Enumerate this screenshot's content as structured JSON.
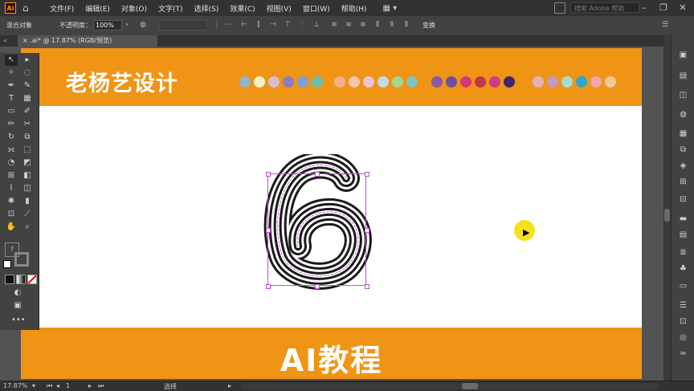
{
  "app": {
    "logo": "Ai",
    "menu": [
      "文件(F)",
      "编辑(E)",
      "对象(O)",
      "文字(T)",
      "选择(S)",
      "效果(C)",
      "视图(V)",
      "窗口(W)",
      "帮助(H)"
    ],
    "search_placeholder": "搜索 Adobe 帮助"
  },
  "control": {
    "object_type": "混合对象",
    "opacity_label": "不透明度：",
    "opacity_value": "100%",
    "dim_field": "",
    "transform_label": "变换"
  },
  "document": {
    "tab_title": ".ai* @ 17.87% (RGB/预览)"
  },
  "artboard": {
    "brand_title": "老杨艺设计",
    "course_title": "AI教程",
    "glyph": "6",
    "colors": {
      "banner": "#ef9414",
      "accent": "#ff9a00",
      "selection": "#c44bd6"
    },
    "swatches": [
      "#8fb6c9",
      "#f3f0c8",
      "#d8bcd0",
      "#8f7bc0",
      "#7ea0d8",
      "#6bbfb0",
      "#f4b28a",
      "#f6c7b0",
      "#f0c2d8",
      "#c6d8ea",
      "#a7d48e",
      "#7cc7c0",
      "#8c5aa6",
      "#6b4fa0",
      "#d23b7a",
      "#c2364e",
      "#c93d8a",
      "#3a2a6a",
      "#e2b2b8",
      "#c09ac8",
      "#a8dcd0",
      "#2aa7d0",
      "#f0a6b0",
      "#f0c89a"
    ]
  },
  "status": {
    "zoom": "17.87%",
    "artboard_num": "1",
    "mode": "选择"
  }
}
